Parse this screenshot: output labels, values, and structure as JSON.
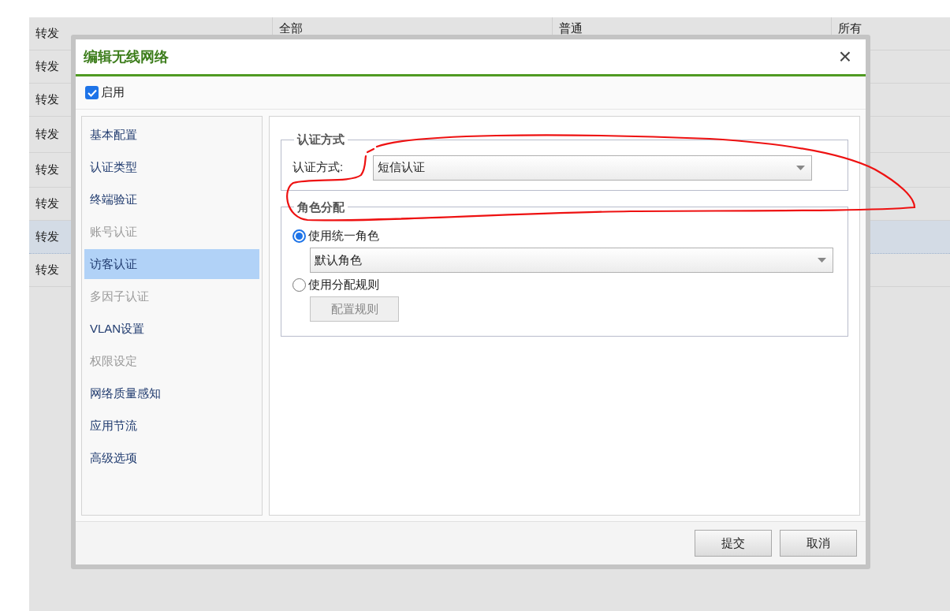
{
  "background_table": {
    "rows": [
      {
        "cells": [
          "转发",
          "全部",
          "普通",
          "所有"
        ],
        "selected": false
      },
      {
        "cells": [
          "转发"
        ],
        "selected": false
      },
      {
        "cells": [
          "转发"
        ],
        "selected": false
      },
      {
        "cells": [
          "转发"
        ],
        "selected": false
      },
      {
        "cells": [
          "转发"
        ],
        "selected": false
      },
      {
        "cells": [
          "转发"
        ],
        "selected": false
      },
      {
        "cells": [
          "转发"
        ],
        "selected": true
      },
      {
        "cells": [
          "转发"
        ],
        "selected": false
      }
    ]
  },
  "dialog": {
    "title": "编辑无线网络",
    "close": "×",
    "enable": {
      "label": "启用",
      "checked": true
    },
    "nav": [
      {
        "label": "基本配置",
        "selected": false,
        "disabled": false
      },
      {
        "label": "认证类型",
        "selected": false,
        "disabled": false
      },
      {
        "label": "终端验证",
        "selected": false,
        "disabled": false
      },
      {
        "label": "账号认证",
        "selected": false,
        "disabled": true
      },
      {
        "label": "访客认证",
        "selected": true,
        "disabled": false
      },
      {
        "label": "多因子认证",
        "selected": false,
        "disabled": true
      },
      {
        "label": "VLAN设置",
        "selected": false,
        "disabled": false
      },
      {
        "label": "权限设定",
        "selected": false,
        "disabled": true
      },
      {
        "label": "网络质量感知",
        "selected": false,
        "disabled": false
      },
      {
        "label": "应用节流",
        "selected": false,
        "disabled": false
      },
      {
        "label": "高级选项",
        "selected": false,
        "disabled": false
      }
    ],
    "auth_section": {
      "legend": "认证方式",
      "label": "认证方式:",
      "value": "短信认证"
    },
    "role_section": {
      "legend": "角色分配",
      "options": [
        {
          "kind": "select",
          "label": "使用统一角色",
          "selected": true,
          "value": "默认角色"
        },
        {
          "kind": "button",
          "label": "使用分配规则",
          "selected": false,
          "button": "配置规则"
        }
      ]
    },
    "buttons": [
      "提交",
      "取消"
    ]
  }
}
